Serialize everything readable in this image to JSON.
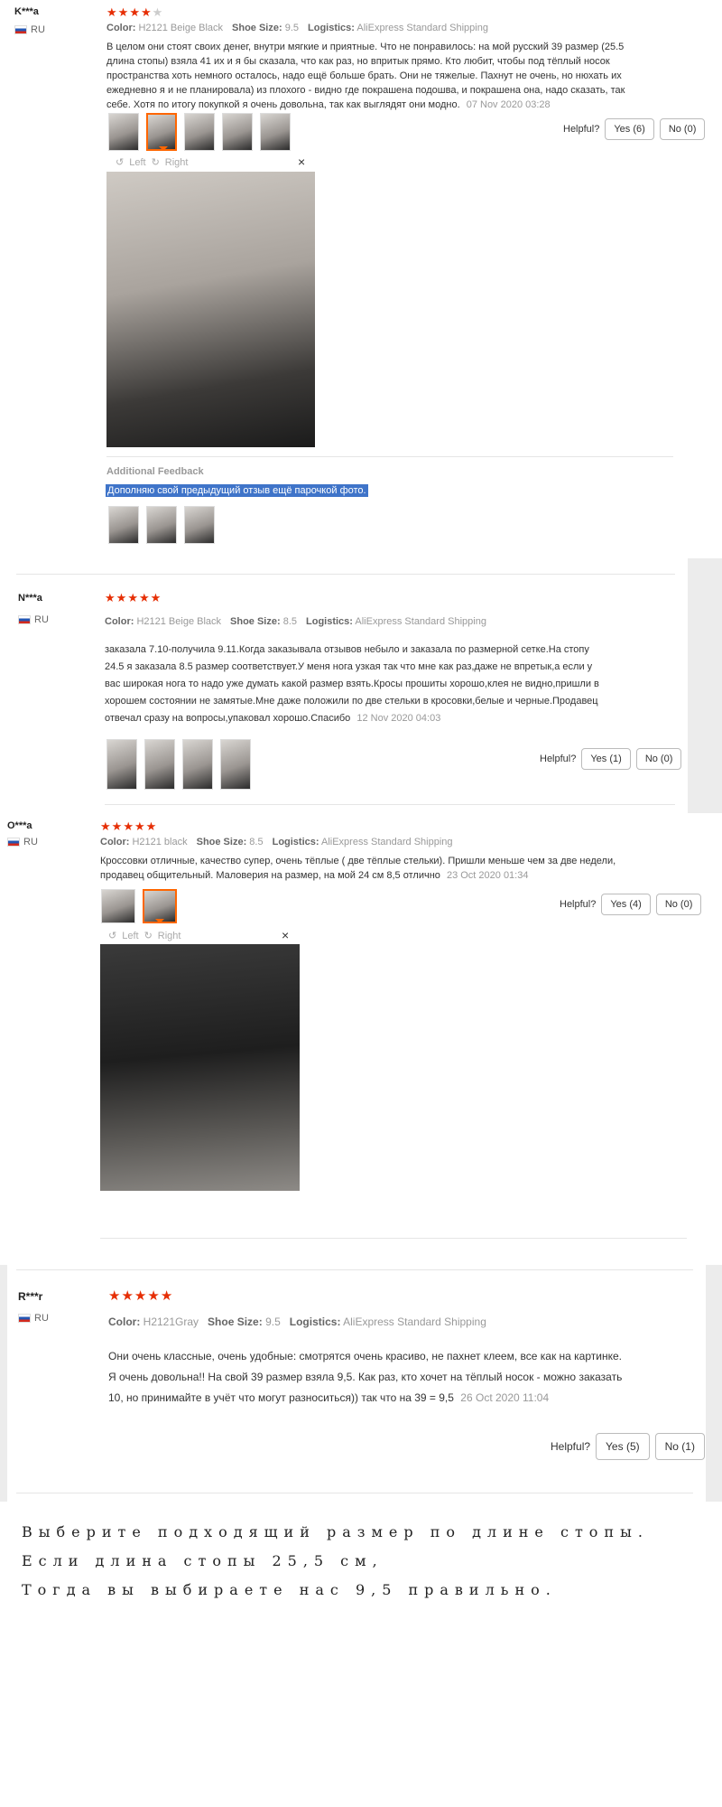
{
  "reviews": [
    {
      "user": "K***a",
      "country": "RU",
      "rating": 4,
      "color_label": "Color:",
      "color_value": "H2121 Beige Black",
      "size_label": "Shoe Size:",
      "size_value": "9.5",
      "logistics_label": "Logistics:",
      "logistics_value": "AliExpress Standard Shipping",
      "text": "В целом они стоят своих денег, внутри мягкие и приятные. Что не понравилось: на мой русский 39 размер (25.5 длина стопы) взяла 41 их и я бы сказала, что как раз, но впритык прямо. Кто любит, чтобы под тёплый носок пространства хоть немного осталось, надо ещё больше брать. Они не тяжелые. Пахнут не очень, но нюхать их ежедневно я и не планировала) из плохого - видно где покрашена подошва, и покрашена она, надо сказать, так себе. Хотя по итогу покупкой я очень довольна, так как выглядят они модно.",
      "date": "07 Nov 2020 03:28",
      "helpful_label": "Helpful?",
      "yes_label": "Yes (6)",
      "no_label": "No (0)",
      "viewer_left": "Left",
      "viewer_right": "Right",
      "additional_label": "Additional Feedback",
      "additional_text": "Дополняю свой предыдущий отзыв ещё парочкой фото."
    },
    {
      "user": "N***a",
      "country": "RU",
      "rating": 5,
      "color_label": "Color:",
      "color_value": "H2121 Beige Black",
      "size_label": "Shoe Size:",
      "size_value": "8.5",
      "logistics_label": "Logistics:",
      "logistics_value": "AliExpress Standard Shipping",
      "text": "заказала 7.10-получила 9.11.Когда заказывала отзывов небыло и заказала по размерной сетке.На стопу 24.5 я заказала 8.5 размер соответствует.У меня нога узкая так что мне как раз,даже не впретык,а если у вас широкая нога то надо уже думать какой размер взять.Кросы прошиты хорошо,клея не видно,пришли в хорошем состоянии не замятые.Мне даже положили по две стельки в кросовки,белые и черные.Продавец отвечал сразу на вопросы,упаковал хорошо.Спасибо",
      "date": "12 Nov 2020 04:03",
      "helpful_label": "Helpful?",
      "yes_label": "Yes (1)",
      "no_label": "No (0)"
    },
    {
      "user": "O***a",
      "country": "RU",
      "rating": 5,
      "color_label": "Color:",
      "color_value": "H2121 black",
      "size_label": "Shoe Size:",
      "size_value": "8.5",
      "logistics_label": "Logistics:",
      "logistics_value": "AliExpress Standard Shipping",
      "text": "Кроссовки отличные, качество супер, очень тёплые ( две тёплые стельки). Пришли меньше чем за две недели, продавец общительный. Маловерия на размер, на мой 24 см 8,5 отлично",
      "date": "23 Oct 2020 01:34",
      "helpful_label": "Helpful?",
      "yes_label": "Yes (4)",
      "no_label": "No (0)",
      "viewer_left": "Left",
      "viewer_right": "Right"
    },
    {
      "user": "R***r",
      "country": "RU",
      "rating": 5,
      "color_label": "Color:",
      "color_value": "H2121Gray",
      "size_label": "Shoe Size:",
      "size_value": "9.5",
      "logistics_label": "Logistics:",
      "logistics_value": "AliExpress Standard Shipping",
      "text": "Они очень классные, очень удобные: смотрятся очень красиво, не пахнет клеем, все как на картинке. Я очень довольна!! На свой 39 размер взяла 9,5. Как раз, кто хочет на тёплый носок - можно заказать 10, но принимайте в учёт что могут разноситься)) так что на 39 = 9,5",
      "date": "26 Oct 2020 11:04",
      "helpful_label": "Helpful?",
      "yes_label": "Yes (5)",
      "no_label": "No (1)"
    }
  ],
  "bottom_note": {
    "line1": "Выберите подходящий размер по длине стопы.",
    "line2": "Если длина стопы 25,5 см,",
    "line3": "Тогда вы выбираете нас 9,5 правильно."
  },
  "icons": {
    "star": "★",
    "rotate_left": "↺",
    "rotate_right": "↻",
    "close": "×"
  },
  "colors": {
    "star_active": "#e62e04",
    "star_inactive": "#cccccc",
    "highlight": "#3f74c9",
    "thumb_selected": "#ff6600"
  }
}
